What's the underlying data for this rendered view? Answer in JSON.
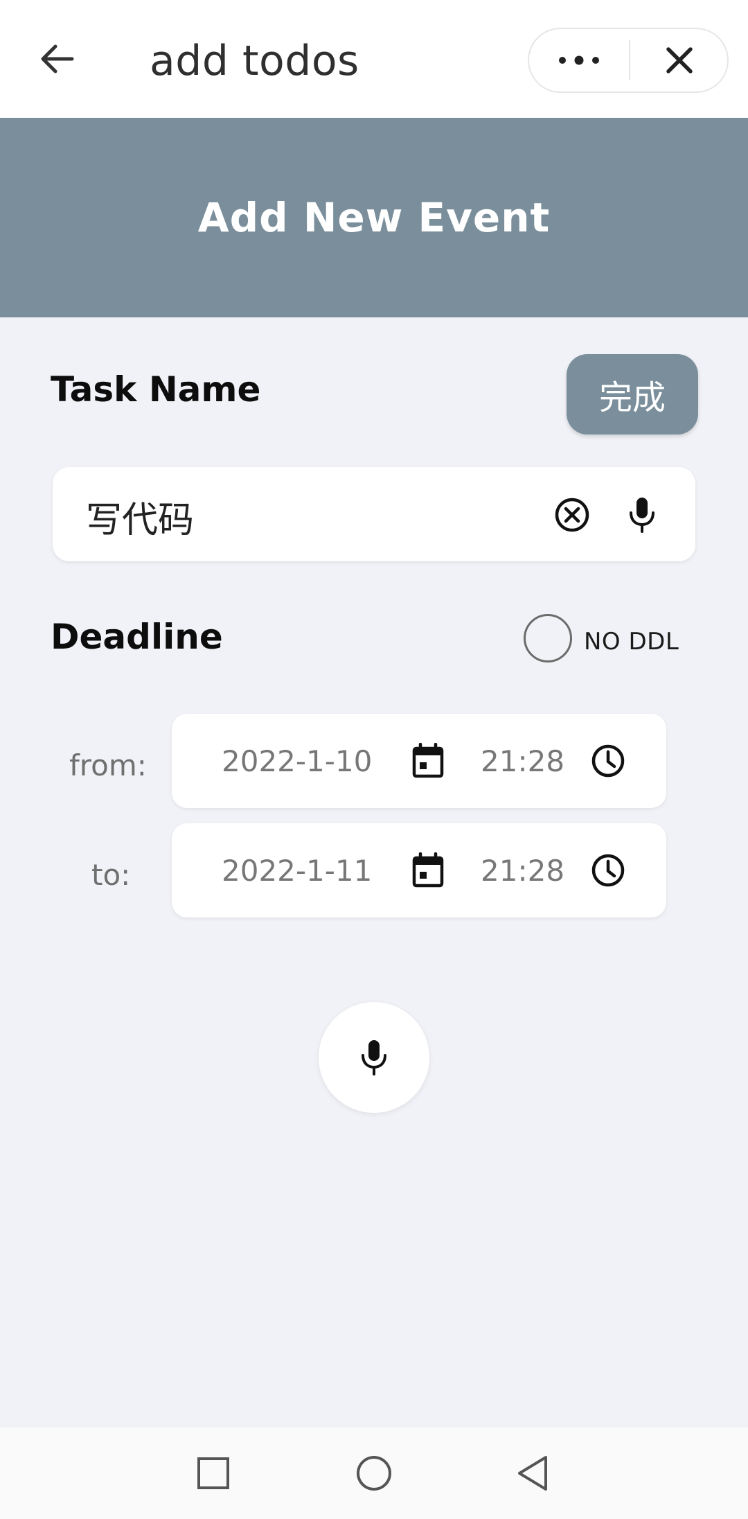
{
  "topbar": {
    "title": "add todos",
    "back_icon": "arrow-left-icon",
    "more_icon": "more-dots-icon",
    "close_icon": "close-icon"
  },
  "banner": {
    "title": "Add New Event",
    "color": "#7a8f9b"
  },
  "task": {
    "label": "Task Name",
    "done_label": "完成",
    "value": "写代码",
    "clear_icon": "clear-circle-icon",
    "mic_icon": "microphone-icon"
  },
  "deadline": {
    "label": "Deadline",
    "no_ddl_label": "NO DDL",
    "no_ddl_checked": false,
    "from": {
      "label": "from:",
      "date": "2022-1-10",
      "time": "21:28"
    },
    "to": {
      "label": "to:",
      "date": "2022-1-11",
      "time": "21:28"
    }
  },
  "voice": {
    "icon": "microphone-icon"
  },
  "navbar": {
    "icons": [
      "square-recents-icon",
      "circle-home-icon",
      "triangle-back-icon"
    ]
  }
}
